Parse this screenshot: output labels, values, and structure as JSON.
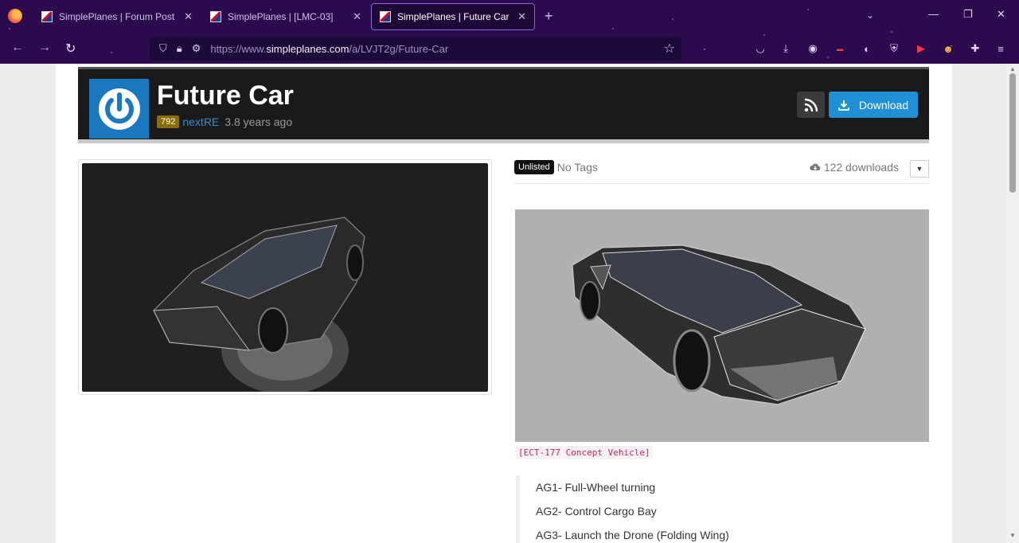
{
  "browser": {
    "tabs": [
      {
        "label": "SimplePlanes | Forum Post",
        "active": false
      },
      {
        "label": "SimplePlanes | [LMC-03]",
        "active": false
      },
      {
        "label": "SimplePlanes | Future Car",
        "active": true
      }
    ],
    "url_prefix": "https://www.",
    "url_domain": "simpleplanes.com",
    "url_path": "/a/LVJT2g/Future-Car",
    "colors": {
      "chrome": "#2b0a4d",
      "urlbar": "#1c0b3a",
      "tab_border": "#7f6bd8"
    }
  },
  "header": {
    "title": "Future Car",
    "points": "792",
    "author": "nextRE",
    "age": "3.8 years ago",
    "download_label": "Download",
    "colors": {
      "background": "#1a1a1a",
      "avatar": "#1a79be",
      "download": "#1f8fd6",
      "badge": "#8a6f00",
      "author": "#2b8fd6"
    }
  },
  "details": {
    "visibility_badge": "Unlisted",
    "tags_text": "No Tags",
    "downloads_text": "122 downloads",
    "caption": "[ECT-177 Concept Vehicle]",
    "action_groups": [
      "AG1- Full-Wheel turning",
      "AG2- Control Cargo Bay",
      "AG3- Launch the Drone (Folding Wing)"
    ]
  }
}
